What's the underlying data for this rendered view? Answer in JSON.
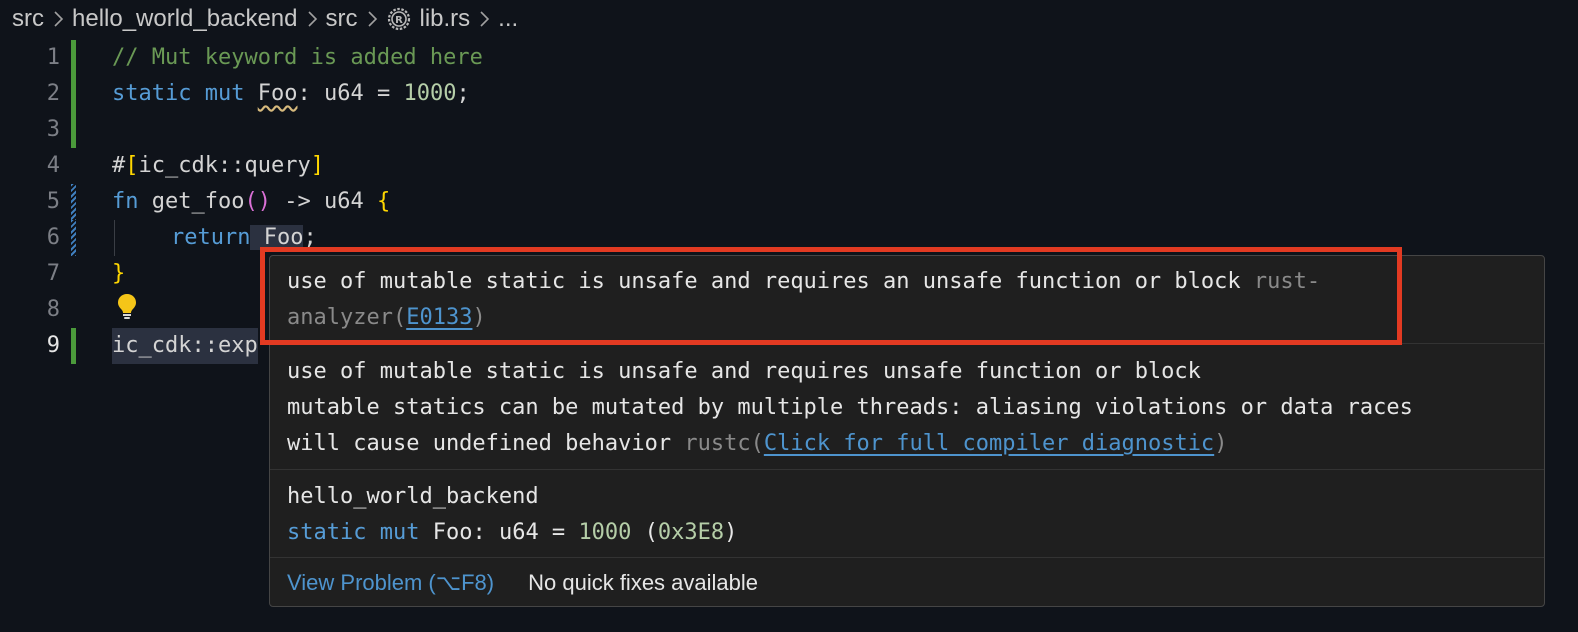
{
  "breadcrumb": {
    "items": [
      "src",
      "hello_world_backend",
      "src",
      "lib.rs",
      "..."
    ]
  },
  "colors": {
    "background": "#0f131a",
    "gutter_added": "#4b9a3b",
    "gutter_modified": "#3f7fbf",
    "highlight_box": "#e23a22",
    "link": "#4e94ce"
  },
  "editor": {
    "line_numbers": [
      "1",
      "2",
      "3",
      "4",
      "5",
      "6",
      "7",
      "8",
      "9"
    ],
    "lines": {
      "l1": "// Mut keyword is added here",
      "l2": {
        "static": "static",
        "mut": "mut",
        "foo": "Foo",
        "rest": ": u64 = ",
        "num": "1000",
        "semi": ";"
      },
      "l4": {
        "hash": "#",
        "open": "[",
        "attr": "ic_cdk::query",
        "close": "]"
      },
      "l5": {
        "fn": "fn",
        "name": " get_foo",
        "parens": "()",
        "arrow": " -> u64 ",
        "brace": "{"
      },
      "l6": {
        "ret": "return",
        "foo": " Foo",
        "semi": ";"
      },
      "l7": "}",
      "l9": "ic_cdk::exp"
    }
  },
  "hover": {
    "section1": {
      "line1": "use of mutable static is unsafe and requires an unsafe function or block ",
      "source_a": "rust-",
      "source_b": "analyzer(",
      "code": "E0133",
      "close": ")"
    },
    "section2": {
      "line1": "use of mutable static is unsafe and requires unsafe function or block",
      "line2": "mutable statics can be mutated by multiple threads: aliasing violations or data races",
      "line3": "will cause undefined behavior ",
      "source": "rustc(",
      "link": "Click for full compiler diagnostic",
      "close": ")"
    },
    "section3": {
      "crate": "hello_world_backend",
      "static": "static",
      "mut": "mut",
      "rest": " Foo: u64 = ",
      "num": "1000",
      "hex_open": " (",
      "hex": "0x3E8",
      "hex_close": ")"
    },
    "footer": {
      "view_problem": "View Problem (⌥F8)",
      "no_fixes": "No quick fixes available"
    }
  }
}
